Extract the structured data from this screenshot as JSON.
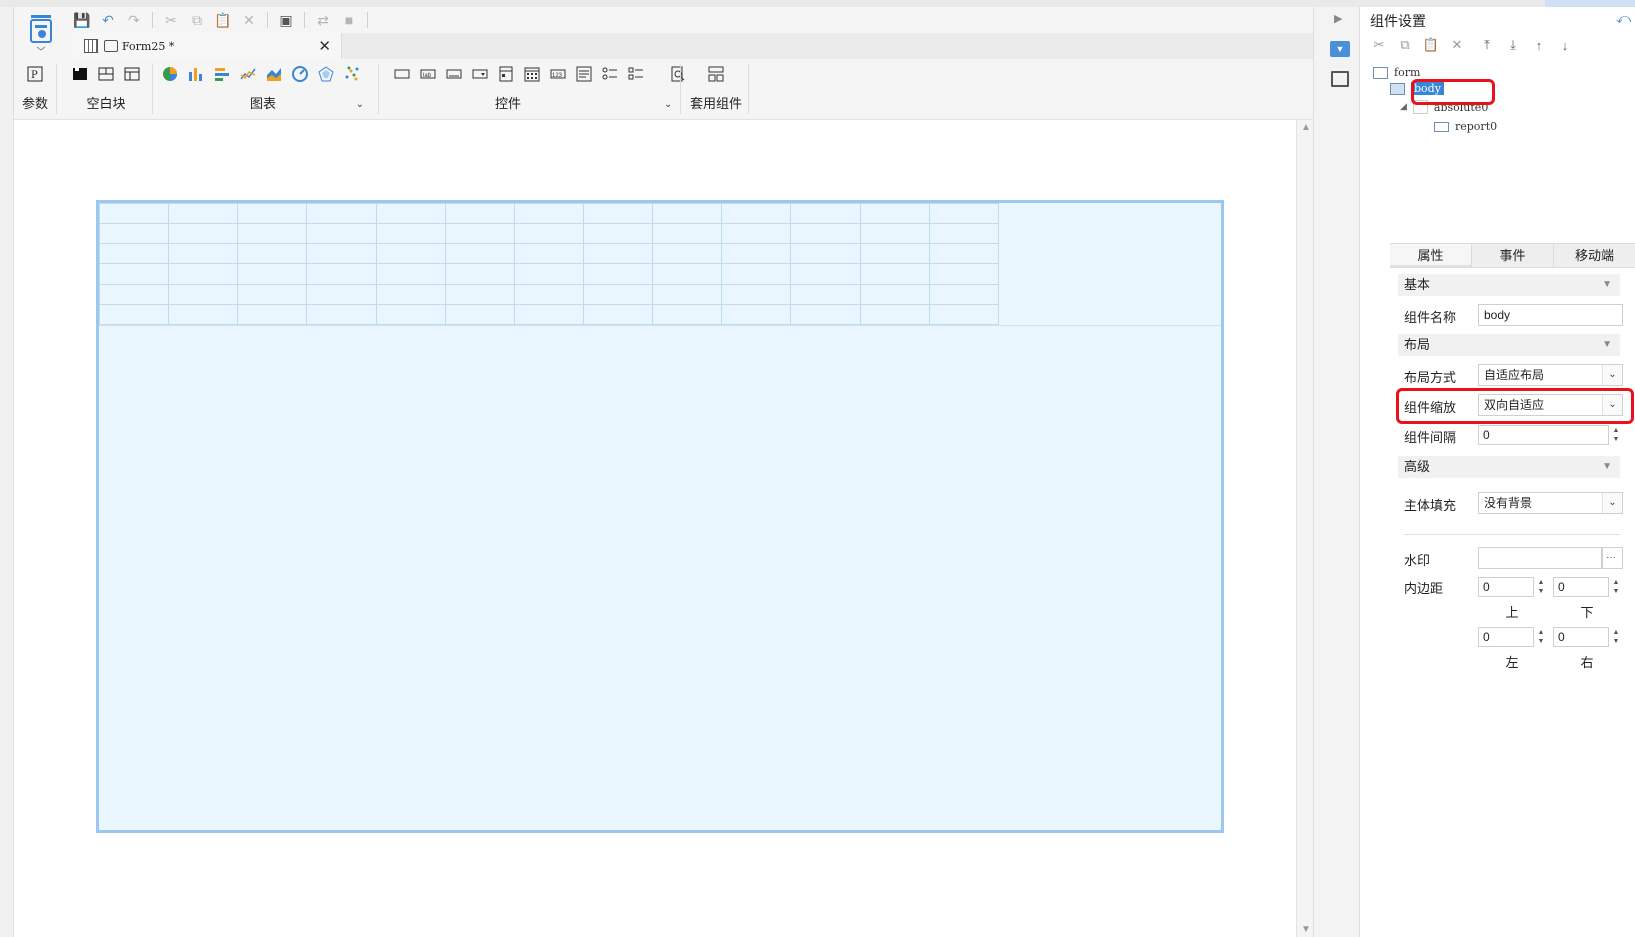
{
  "document_tab": {
    "label": "Form25 *"
  },
  "quick_toolbar": {
    "icons": [
      "save-icon",
      "undo-icon",
      "redo-icon",
      "cut-icon",
      "copy-icon",
      "paste-icon",
      "delete-icon",
      "preview-icon",
      "switch-icon",
      "square-icon"
    ]
  },
  "ribbon": {
    "groups": [
      {
        "label": "参数",
        "icons": [
          "parameter-icon"
        ]
      },
      {
        "label": "空白块",
        "icons": [
          "black-block-icon",
          "split-block-icon",
          "grid-block-icon"
        ]
      },
      {
        "label": "图表",
        "icons": [
          "pie-chart-icon",
          "bar-chart-icon",
          "horizontal-bar-icon",
          "line-chart-icon",
          "area-chart-icon",
          "gauge-chart-icon",
          "radar-chart-icon",
          "scatter-chart-icon"
        ]
      },
      {
        "label": "控件",
        "icons": [
          "text-box-icon",
          "label-icon",
          "button-icon",
          "dropdown-icon",
          "date-icon",
          "calendar-icon",
          "number-icon",
          "textarea-icon",
          "radio-group-icon",
          "checkbox-group-icon",
          "search-preview-icon"
        ]
      },
      {
        "label": "套用组件",
        "icons": [
          "apply-component-icon"
        ]
      }
    ]
  },
  "right_panel": {
    "title": "组件设置",
    "tree": {
      "form": "form",
      "body": "body",
      "absolute": "absolute0",
      "report": "report0"
    },
    "tabs": [
      "属性",
      "事件",
      "移动端"
    ],
    "sections": {
      "basic": "基本",
      "layout": "布局",
      "advanced": "高级"
    },
    "fields": {
      "component_name_label": "组件名称",
      "component_name_value": "body",
      "layout_mode_label": "布局方式",
      "layout_mode_value": "自适应布局",
      "component_scale_label": "组件缩放",
      "component_scale_value": "双向自适应",
      "component_gap_label": "组件间隔",
      "component_gap_value": "0",
      "body_fill_label": "主体填充",
      "body_fill_value": "没有背景",
      "watermark_label": "水印",
      "watermark_btn": "···",
      "padding_label": "内边距",
      "padding_top": "0",
      "padding_bottom": "0",
      "padding_left": "0",
      "padding_right": "0",
      "top_label": "上",
      "bottom_label": "下",
      "left_label": "左",
      "right_label": "右"
    }
  },
  "colors": {
    "accent": "#3a86d6",
    "highlight_ring": "#e8121d",
    "body_fill": "#eaf6fd",
    "body_border": "#9cc7ee"
  }
}
